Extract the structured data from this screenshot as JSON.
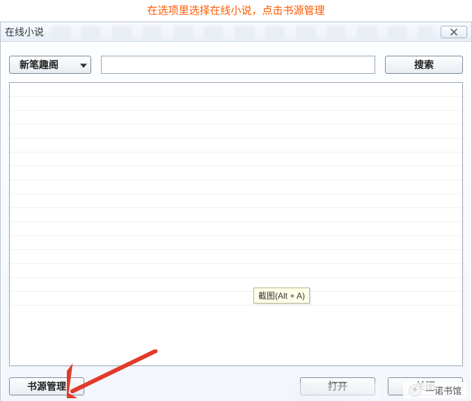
{
  "annotation": "在选项里选择在线小说，点击书源管理",
  "titlebar": {
    "title": "在线小说"
  },
  "search": {
    "source_selected": "新笔趣阁",
    "input_value": "",
    "search_label": "搜索"
  },
  "tooltip": {
    "text": "截图(Alt + A)"
  },
  "buttons": {
    "manage_sources": "书源管理",
    "open": "打开",
    "close": "关闭"
  },
  "watermark": {
    "label": "一诺书馆"
  }
}
